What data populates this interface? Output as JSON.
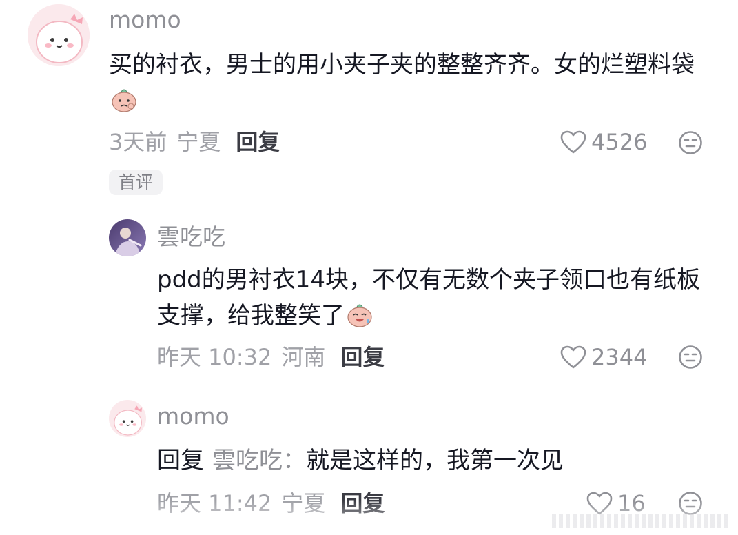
{
  "comments": [
    {
      "username": "momo",
      "text": "买的衬衣，男士的用小夹子夹的整整齐齐。女的烂塑料袋",
      "time": "3天前",
      "location": "宁夏",
      "reply_label": "回复",
      "likes": "4526",
      "badge": "首评",
      "emoji_icon": "thinking-face-emoji",
      "avatar_icon": "pink-dinosaur-avatar"
    },
    {
      "username": "雲吃吃",
      "text": "pdd的男衬衣14块，不仅有无数个夹子领口也有纸板支撑，给我整笑了",
      "time": "昨天 10:32",
      "location": "河南",
      "reply_label": "回复",
      "likes": "2344",
      "emoji_icon": "sweating-laugh-emoji",
      "avatar_icon": "purple-photo-avatar"
    },
    {
      "username": "momo",
      "reply_prefix": "回复",
      "reply_target": "雲吃吃：",
      "text": "就是这样的，我第一次见",
      "time": "昨天 11:42",
      "location": "宁夏",
      "reply_label": "回复",
      "likes": "16",
      "avatar_icon": "pink-dinosaur-avatar"
    }
  ],
  "colors": {
    "username": "#8f9096",
    "text": "#161823",
    "meta": "#a0a1a7",
    "badge_bg": "#f2f2f4",
    "avatar_pink": "#f7dfe3"
  }
}
